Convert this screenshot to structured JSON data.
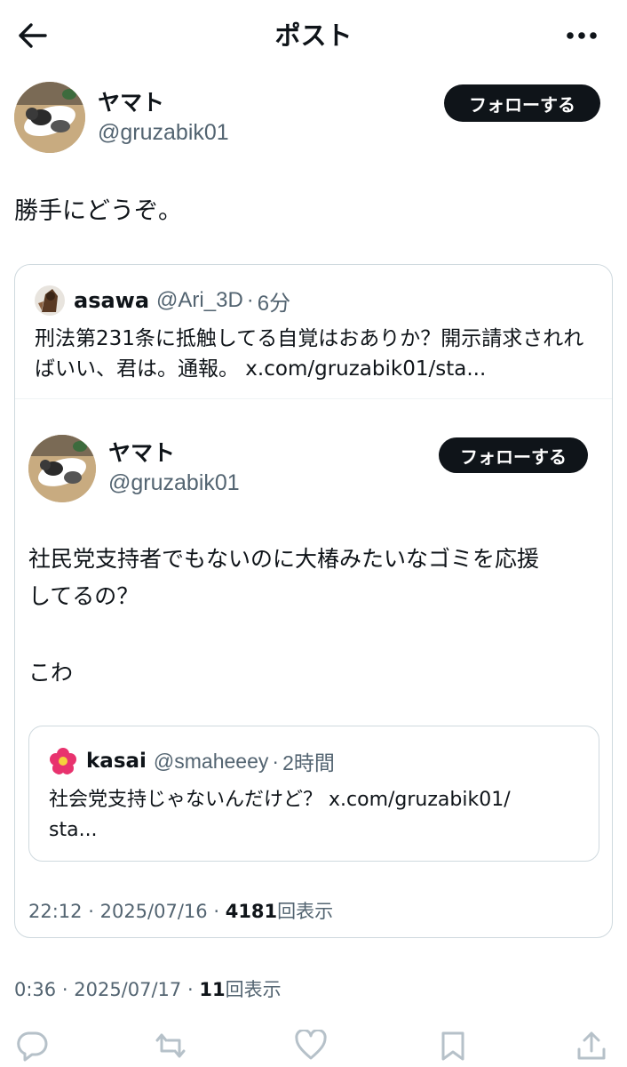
{
  "header": {
    "title": "ポスト"
  },
  "post": {
    "author": {
      "display_name": "ヤマト",
      "handle": "@gruzabik01"
    },
    "follow_label": "フォローする",
    "text": "勝手にどうぞ。",
    "meta": {
      "time": "0:36",
      "date": "2025/07/17",
      "views_count": "11",
      "views_label": "回表示"
    }
  },
  "quote": {
    "author": {
      "display_name": "asawa",
      "handle": "@Ari_3D",
      "time_ago": "6分"
    },
    "text": "刑法第231条に抵触してる自覚はおありか？開示請求されればいい、君は。通報。 x.com/gruzabik01/sta..."
  },
  "inner_post": {
    "author": {
      "display_name": "ヤマト",
      "handle": "@gruzabik01"
    },
    "follow_label": "フォローする",
    "text_line1": "社民党支持者でもないのに大椿みたいなゴミを応援",
    "text_line2": "してるの？",
    "text_line3": "こわ",
    "meta": {
      "time": "22:12",
      "date": "2025/07/16",
      "views_count": "4181",
      "views_label": "回表示"
    }
  },
  "nested_quote": {
    "author": {
      "display_name": "kasai",
      "handle": "@smaheeey",
      "time_ago": "2時間"
    },
    "text_line1": "社会党支持じゃないんだけど？ x.com/gruzabik01/",
    "text_line2": "sta..."
  },
  "separator": "·",
  "icons": [
    "back-arrow-icon",
    "more-icon",
    "reply-icon",
    "repost-icon",
    "like-icon",
    "bookmark-icon",
    "share-icon"
  ],
  "colors": {
    "text": "#0f1419",
    "secondary": "#536471",
    "border": "#cfd9de",
    "button": "#0f1419"
  }
}
